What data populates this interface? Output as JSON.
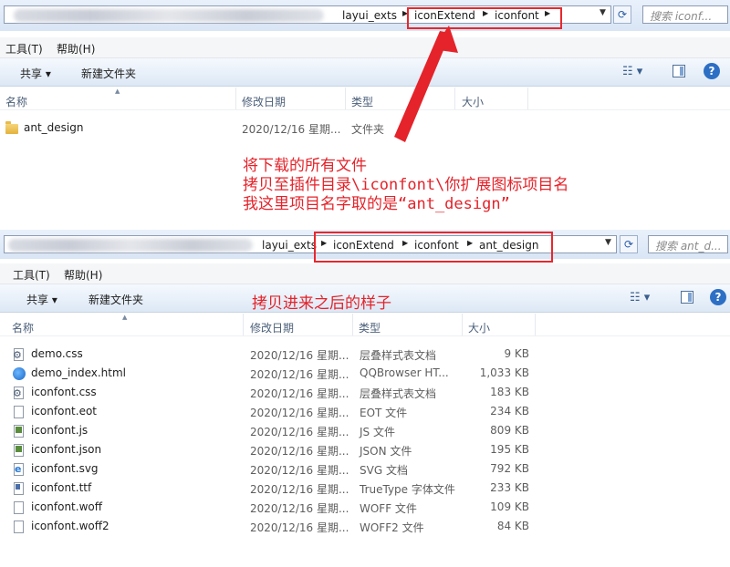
{
  "colors": {
    "annotation_red": "#e4232a",
    "folder_yellow": "#e3b23c",
    "toolbar_blue": "#dde8f5"
  },
  "window1": {
    "breadcrumbs": [
      "layui_exts",
      "iconExtend",
      "iconfont"
    ],
    "search_placeholder": "搜索 iconf...",
    "menu": [
      "工具(T)",
      "帮助(H)"
    ],
    "toolbar": {
      "share": "共享 ▾",
      "new_folder": "新建文件夹"
    },
    "columns": {
      "name": "名称",
      "date": "修改日期",
      "type": "类型",
      "size": "大小"
    },
    "files": [
      {
        "name": "ant_design",
        "date": "2020/12/16 星期...",
        "type": "文件夹",
        "size": "",
        "icon": "folder-icon"
      }
    ]
  },
  "annotation_main": {
    "line1": "将下载的所有文件",
    "line2": "拷贝至插件目录\\iconfont\\你扩展图标项目名",
    "line3": "我这里项目名字取的是“ant_design”"
  },
  "window2": {
    "breadcrumbs": [
      "layui_exts",
      "iconExtend",
      "iconfont",
      "ant_design"
    ],
    "search_placeholder": "搜索 ant_d...",
    "menu": [
      "工具(T)",
      "帮助(H)"
    ],
    "toolbar": {
      "share": "共享 ▾",
      "new_folder": "新建文件夹"
    },
    "annotation": "拷贝进来之后的样子",
    "columns": {
      "name": "名称",
      "date": "修改日期",
      "type": "类型",
      "size": "大小"
    },
    "files": [
      {
        "name": "demo.css",
        "date": "2020/12/16 星期...",
        "type": "层叠样式表文档",
        "size": "9 KB",
        "icon": "css-file-icon"
      },
      {
        "name": "demo_index.html",
        "date": "2020/12/16 星期...",
        "type": "QQBrowser HT...",
        "size": "1,033 KB",
        "icon": "browser-file-icon"
      },
      {
        "name": "iconfont.css",
        "date": "2020/12/16 星期...",
        "type": "层叠样式表文档",
        "size": "183 KB",
        "icon": "css-file-icon"
      },
      {
        "name": "iconfont.eot",
        "date": "2020/12/16 星期...",
        "type": "EOT 文件",
        "size": "234 KB",
        "icon": "blank-file-icon"
      },
      {
        "name": "iconfont.js",
        "date": "2020/12/16 星期...",
        "type": "JS 文件",
        "size": "809 KB",
        "icon": "script-file-icon"
      },
      {
        "name": "iconfont.json",
        "date": "2020/12/16 星期...",
        "type": "JSON 文件",
        "size": "195 KB",
        "icon": "script-file-icon"
      },
      {
        "name": "iconfont.svg",
        "date": "2020/12/16 星期...",
        "type": "SVG 文档",
        "size": "792 KB",
        "icon": "ie-file-icon"
      },
      {
        "name": "iconfont.ttf",
        "date": "2020/12/16 星期...",
        "type": "TrueType 字体文件",
        "size": "233 KB",
        "icon": "font-file-icon"
      },
      {
        "name": "iconfont.woff",
        "date": "2020/12/16 星期...",
        "type": "WOFF 文件",
        "size": "109 KB",
        "icon": "blank-file-icon"
      },
      {
        "name": "iconfont.woff2",
        "date": "2020/12/16 星期...",
        "type": "WOFF2 文件",
        "size": "84 KB",
        "icon": "blank-file-icon"
      }
    ]
  }
}
